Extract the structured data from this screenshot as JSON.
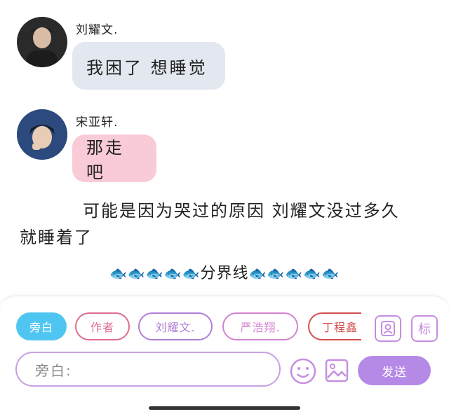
{
  "messages": [
    {
      "name": "刘耀文.",
      "text": "我困了 想睡觉"
    },
    {
      "name": "宋亚轩.",
      "text": "那走吧"
    }
  ],
  "narration": {
    "line1": "可能是因为哭过的原因 刘耀文没过多久",
    "line2": "就睡着了"
  },
  "divider": {
    "fish": "🐟🐟🐟🐟🐟",
    "text": "分界线"
  },
  "roles": [
    "旁白",
    "作者",
    "刘耀文.",
    "严浩翔.",
    "丁程鑫"
  ],
  "icons": {
    "contact": "contact-card-icon",
    "tag_label": "标",
    "emoji": "smile-icon",
    "image": "image-icon"
  },
  "input": {
    "placeholder": "旁白:"
  },
  "send_label": "发送",
  "colors": {
    "active": "#4fc6f2",
    "send": "#b58ae6",
    "bubble_gray": "#e3e8f0",
    "bubble_pink": "#f9cbd6"
  }
}
